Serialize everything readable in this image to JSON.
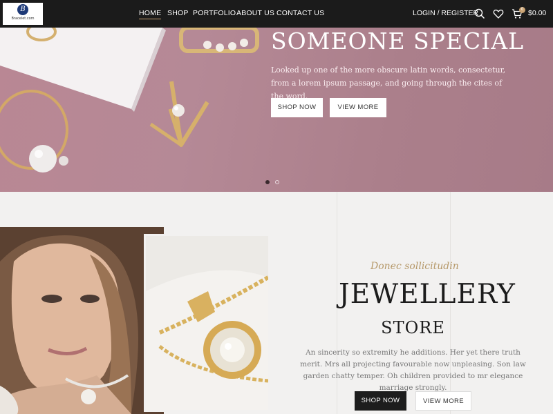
{
  "logo": {
    "mark": "B",
    "text": "Bracelet.com"
  },
  "nav": {
    "items": [
      {
        "label": "HOME",
        "active": true
      },
      {
        "label": "SHOP",
        "active": false
      },
      {
        "label": "PORTFOLIO",
        "active": false
      },
      {
        "label": "ABOUT US",
        "active": false
      },
      {
        "label": "CONTACT US",
        "active": false
      }
    ]
  },
  "header_actions": {
    "login": "LOGIN / REGISTER",
    "cart_count": "0",
    "cart_total": "$0.00",
    "icons": [
      "search-icon",
      "heart-icon",
      "cart-icon"
    ]
  },
  "hero": {
    "title": "SOMEONE SPECIAL",
    "description": "Looked up one of the more obscure latin words, consectetur, from a lorem ipsum passage, and going through the cites of the word.",
    "primary_button": "SHOP NOW",
    "secondary_button": "VIEW MORE",
    "slides_total": 2,
    "active_slide": 1
  },
  "store": {
    "script_heading": "Donec sollicitudin",
    "title": "JEWELLERY",
    "subtitle": "STORE",
    "description": "An sincerity so extremity he additions. Her yet there truth merit. Mrs all projecting favourable now unpleasing. Son law garden chatty temper. Oh children provided to mr elegance marriage strongly.",
    "primary_button": "SHOP NOW",
    "secondary_button": "VIEW MORE"
  },
  "colors": {
    "header_bg": "#1b1b1b",
    "accent_gold": "#caa372",
    "hero_pink": "#b58996"
  }
}
